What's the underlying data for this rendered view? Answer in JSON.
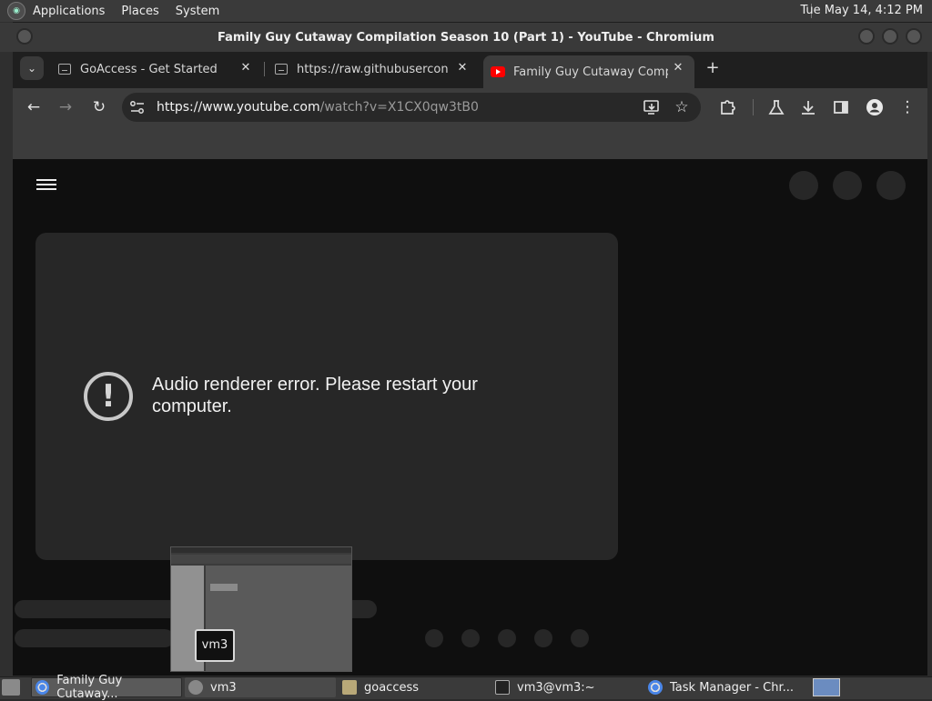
{
  "top_panel": {
    "menus": [
      "Applications",
      "Places",
      "System"
    ],
    "clock": "Tue May 14,  4:12 PM"
  },
  "window": {
    "title": "Family Guy Cutaway Compilation Season 10 (Part 1) - YouTube - Chromium"
  },
  "tabs": [
    {
      "title": "GoAccess - Get Started",
      "active": false
    },
    {
      "title": "https://raw.githubuserconten",
      "active": false
    },
    {
      "title": "Family Guy Cutaway Compila",
      "active": true
    }
  ],
  "toolbar": {
    "back_icon": "←",
    "forward_icon": "→",
    "reload_icon": "↻",
    "url_domain": "https://www.youtube.com",
    "url_path": "/watch?v=X1CX0qw3tB0"
  },
  "page": {
    "error_message": "Audio renderer error. Please restart your computer."
  },
  "preview": {
    "label": "vm3"
  },
  "taskbar": {
    "items": [
      {
        "label": "Family Guy Cutaway...",
        "icon": "chromium-icon",
        "active": true
      },
      {
        "label": "vm3",
        "icon": "vm-icon",
        "active": false
      },
      {
        "label": "goaccess",
        "icon": "folder-icon",
        "active": false
      },
      {
        "label": "vm3@vm3:~",
        "icon": "terminal-icon",
        "active": false
      },
      {
        "label": "Task Manager - Chr...",
        "icon": "chromium-icon",
        "active": false
      }
    ]
  },
  "colors": {
    "page_bg": "#0f0f0f",
    "player_bg": "#272727",
    "youtube_red": "#ff0000"
  }
}
